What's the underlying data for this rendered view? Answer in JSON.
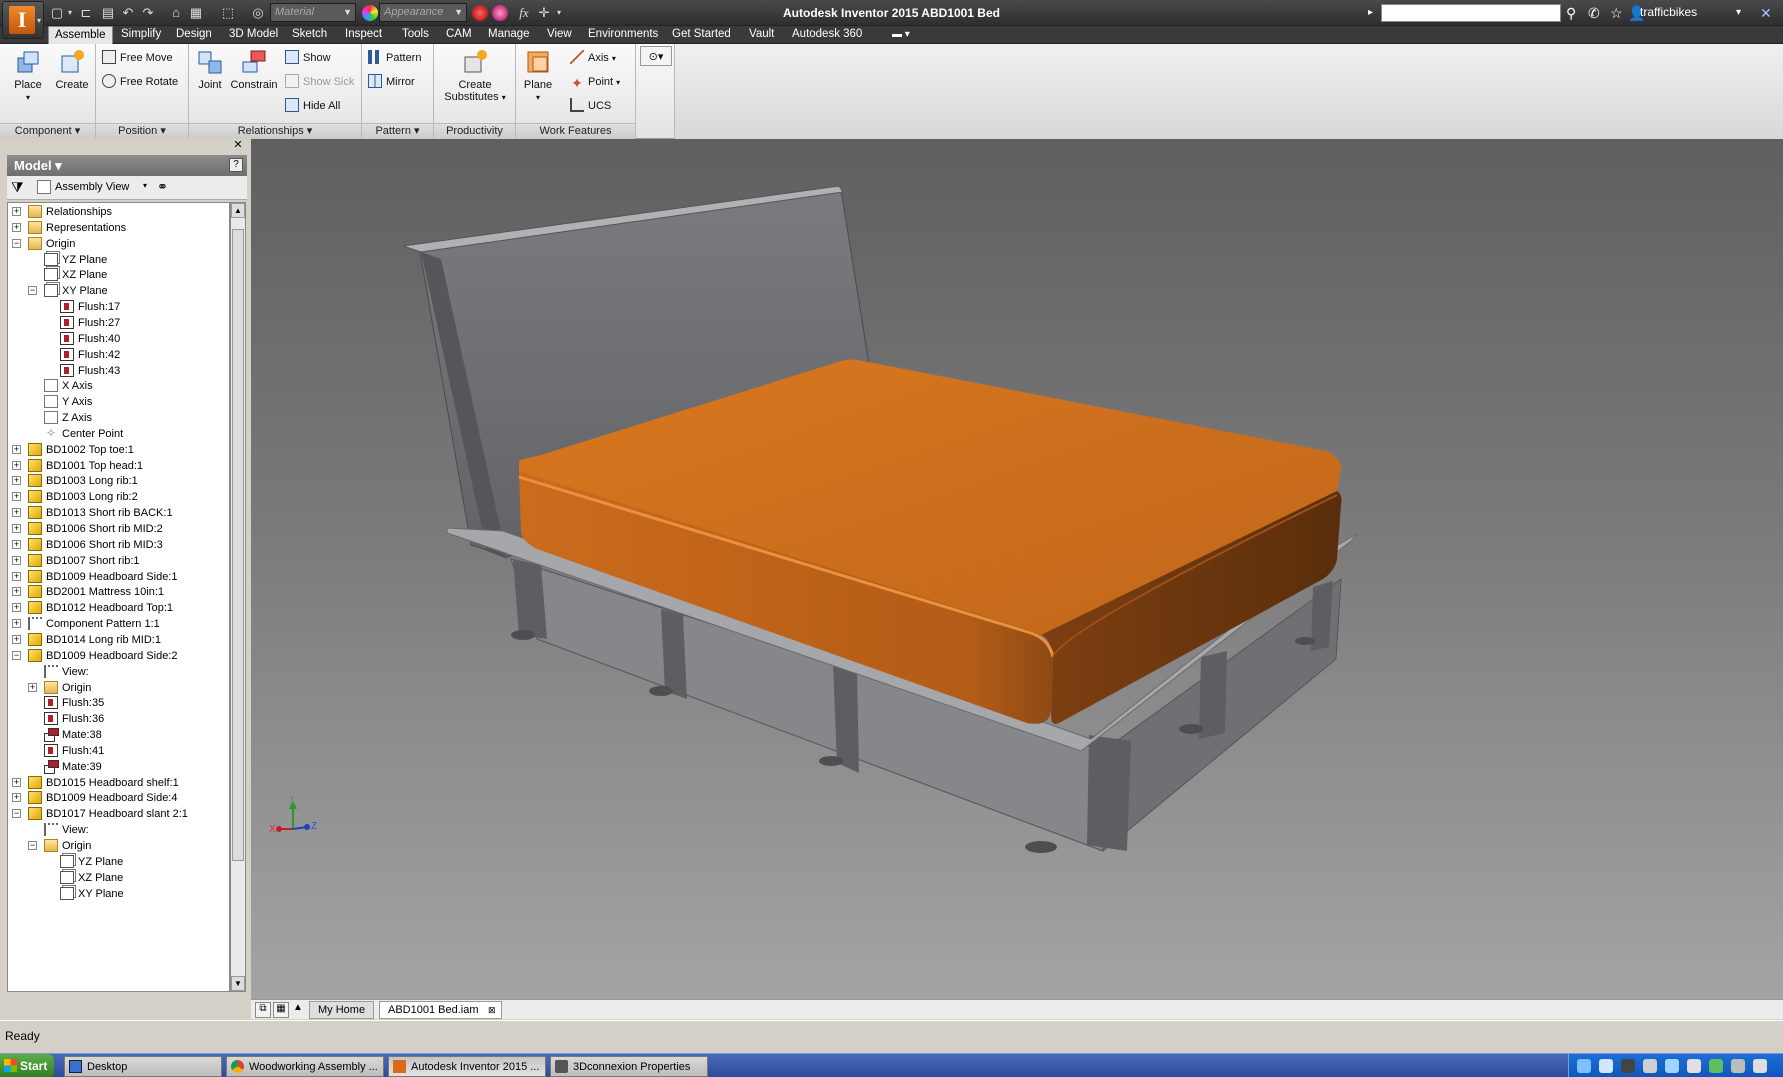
{
  "window": {
    "title": "Autodesk Inventor 2015    ABD1001 Bed",
    "user": "trafficbikes"
  },
  "quick_access": {
    "material_placeholder": "Material",
    "appearance_placeholder": "Appearance",
    "fx_label": "fx"
  },
  "menu_tabs": [
    "Assemble",
    "Simplify",
    "Design",
    "3D Model",
    "Sketch",
    "Inspect",
    "Tools",
    "CAM",
    "Manage",
    "View",
    "Environments",
    "Get Started",
    "Vault",
    "Autodesk 360"
  ],
  "ribbon": {
    "component": {
      "label": "Component ▾",
      "place": "Place",
      "create": "Create"
    },
    "position": {
      "label": "Position ▾",
      "free_move": "Free Move",
      "free_rotate": "Free Rotate"
    },
    "relationships": {
      "label": "Relationships ▾",
      "joint": "Joint",
      "constrain": "Constrain",
      "show": "Show",
      "show_sick": "Show Sick",
      "hide_all": "Hide All"
    },
    "pattern": {
      "label": "Pattern ▾",
      "pattern": "Pattern",
      "mirror": "Mirror"
    },
    "productivity": {
      "label": "Productivity",
      "create": "Create",
      "substitutes": "Substitutes"
    },
    "work_features": {
      "label": "Work Features",
      "plane": "Plane",
      "axis": "Axis",
      "point": "Point",
      "ucs": "UCS"
    }
  },
  "browser": {
    "title": "Model ▾",
    "help": "?",
    "view_mode": "Assembly View",
    "tree": [
      {
        "d": 0,
        "exp": "+",
        "icon": "folder",
        "label": "Relationships"
      },
      {
        "d": 0,
        "exp": "+",
        "icon": "folder",
        "label": "Representations"
      },
      {
        "d": 0,
        "exp": "-",
        "icon": "folder",
        "label": "Origin"
      },
      {
        "d": 1,
        "exp": "",
        "icon": "plane",
        "label": "YZ Plane"
      },
      {
        "d": 1,
        "exp": "",
        "icon": "plane",
        "label": "XZ Plane"
      },
      {
        "d": 1,
        "exp": "-",
        "icon": "plane",
        "label": "XY Plane"
      },
      {
        "d": 2,
        "exp": "",
        "icon": "con",
        "label": "Flush:17"
      },
      {
        "d": 2,
        "exp": "",
        "icon": "con",
        "label": "Flush:27"
      },
      {
        "d": 2,
        "exp": "",
        "icon": "con",
        "label": "Flush:40"
      },
      {
        "d": 2,
        "exp": "",
        "icon": "con",
        "label": "Flush:42"
      },
      {
        "d": 2,
        "exp": "",
        "icon": "con",
        "label": "Flush:43"
      },
      {
        "d": 1,
        "exp": "",
        "icon": "axis",
        "label": "X Axis"
      },
      {
        "d": 1,
        "exp": "",
        "icon": "axis",
        "label": "Y Axis"
      },
      {
        "d": 1,
        "exp": "",
        "icon": "axis",
        "label": "Z Axis"
      },
      {
        "d": 1,
        "exp": "",
        "icon": "pt",
        "label": "Center Point"
      },
      {
        "d": 0,
        "exp": "+",
        "icon": "part",
        "label": "BD1002 Top toe:1"
      },
      {
        "d": 0,
        "exp": "+",
        "icon": "part",
        "label": "BD1001 Top head:1"
      },
      {
        "d": 0,
        "exp": "+",
        "icon": "part",
        "label": "BD1003 Long rib:1"
      },
      {
        "d": 0,
        "exp": "+",
        "icon": "part",
        "label": "BD1003 Long rib:2"
      },
      {
        "d": 0,
        "exp": "+",
        "icon": "part",
        "label": "BD1013 Short rib BACK:1"
      },
      {
        "d": 0,
        "exp": "+",
        "icon": "part",
        "label": "BD1006 Short rib MID:2"
      },
      {
        "d": 0,
        "exp": "+",
        "icon": "part",
        "label": "BD1006 Short rib MID:3"
      },
      {
        "d": 0,
        "exp": "+",
        "icon": "part",
        "label": "BD1007 Short rib:1"
      },
      {
        "d": 0,
        "exp": "+",
        "icon": "part",
        "label": "BD1009 Headboard Side:1"
      },
      {
        "d": 0,
        "exp": "+",
        "icon": "part",
        "label": "BD2001 Mattress 10in:1"
      },
      {
        "d": 0,
        "exp": "+",
        "icon": "part",
        "label": "BD1012 Headboard Top:1"
      },
      {
        "d": 0,
        "exp": "+",
        "icon": "view",
        "label": "Component Pattern 1:1"
      },
      {
        "d": 0,
        "exp": "+",
        "icon": "part",
        "label": "BD1014 Long rib MID:1"
      },
      {
        "d": 0,
        "exp": "-",
        "icon": "part",
        "label": "BD1009 Headboard Side:2"
      },
      {
        "d": 1,
        "exp": "",
        "icon": "view",
        "label": "View:"
      },
      {
        "d": 1,
        "exp": "+",
        "icon": "folder",
        "label": "Origin"
      },
      {
        "d": 1,
        "exp": "",
        "icon": "con",
        "label": "Flush:35"
      },
      {
        "d": 1,
        "exp": "",
        "icon": "con",
        "label": "Flush:36"
      },
      {
        "d": 1,
        "exp": "",
        "icon": "mate",
        "label": "Mate:38"
      },
      {
        "d": 1,
        "exp": "",
        "icon": "con",
        "label": "Flush:41"
      },
      {
        "d": 1,
        "exp": "",
        "icon": "mate",
        "label": "Mate:39"
      },
      {
        "d": 0,
        "exp": "+",
        "icon": "part",
        "label": "BD1015 Headboard shelf:1"
      },
      {
        "d": 0,
        "exp": "+",
        "icon": "part",
        "label": "BD1009 Headboard Side:4"
      },
      {
        "d": 0,
        "exp": "-",
        "icon": "part",
        "label": "BD1017 Headboard slant 2:1"
      },
      {
        "d": 1,
        "exp": "",
        "icon": "view",
        "label": "View:"
      },
      {
        "d": 1,
        "exp": "-",
        "icon": "folder",
        "label": "Origin"
      },
      {
        "d": 2,
        "exp": "",
        "icon": "plane",
        "label": "YZ Plane"
      },
      {
        "d": 2,
        "exp": "",
        "icon": "plane",
        "label": "XZ Plane"
      },
      {
        "d": 2,
        "exp": "",
        "icon": "plane",
        "label": "XY Plane"
      }
    ]
  },
  "triad": {
    "x": "X",
    "y": "Y",
    "z": "Z"
  },
  "doc_tabs": [
    "My Home",
    "ABD1001 Bed.iam"
  ],
  "status": "Ready",
  "taskbar": {
    "start": "Start",
    "items": [
      "Desktop",
      "Woodworking Assembly ...",
      "Autodesk Inventor 2015 ...",
      "3Dconnexion Properties"
    ]
  },
  "colors": {
    "accent": "#e07a1c",
    "mattress": "#c96a1c",
    "frame": "#8e8f92"
  }
}
